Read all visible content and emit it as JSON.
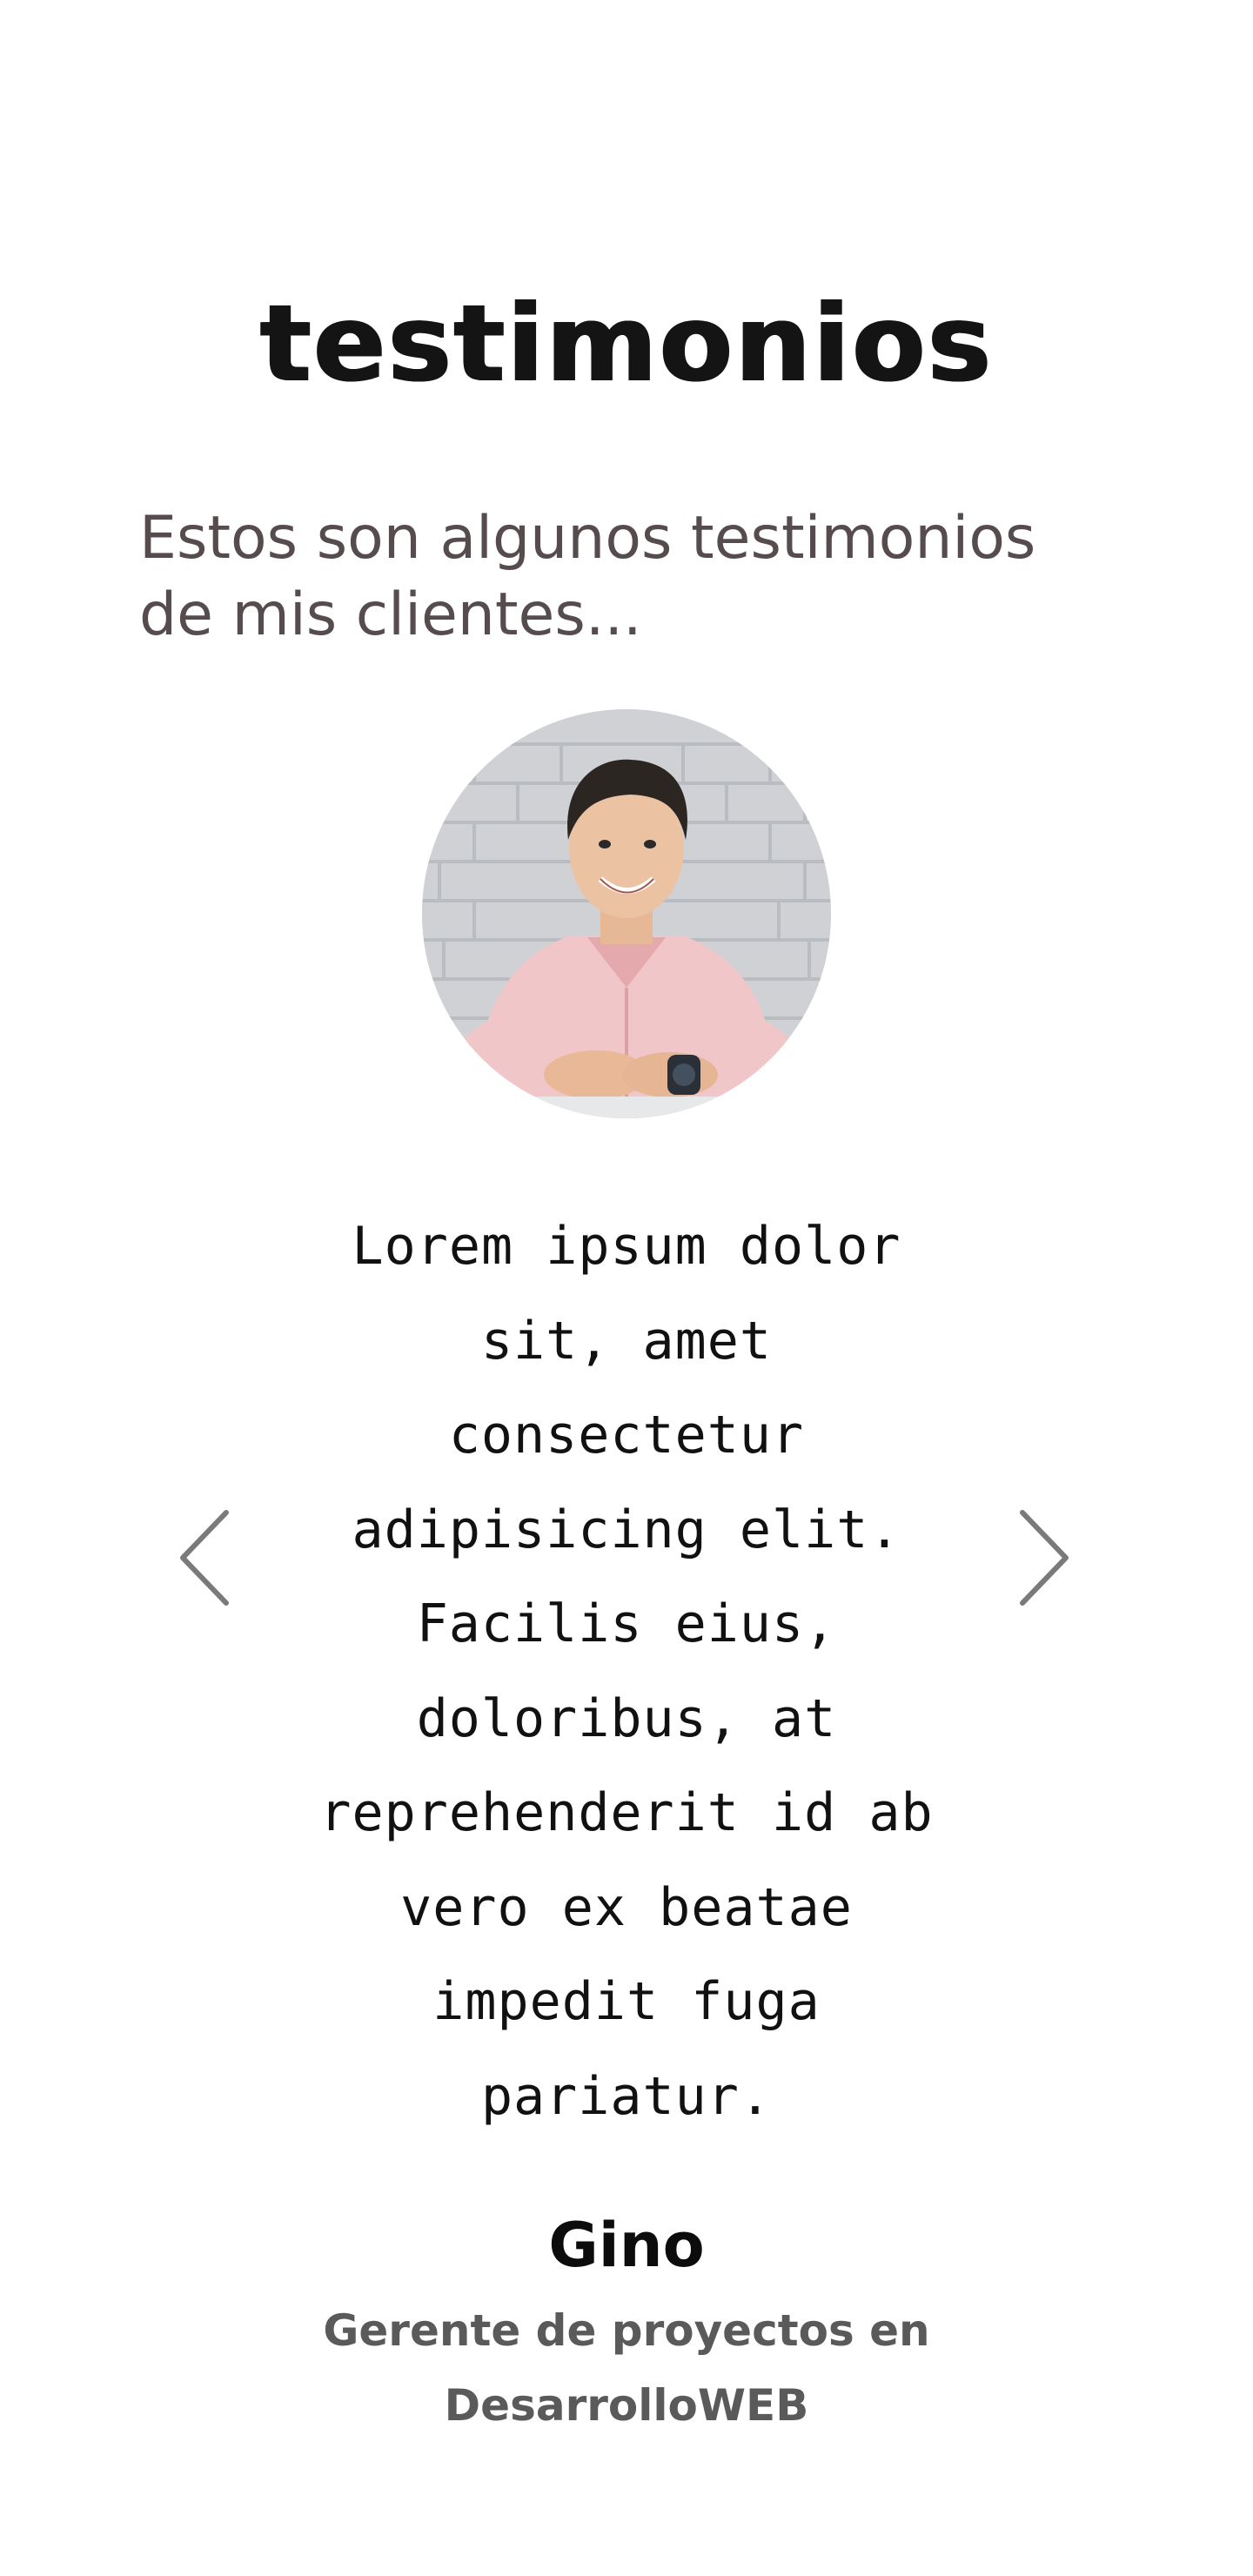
{
  "testimonials": {
    "title": "testimonios",
    "intro": "Estos son algunos testimonios de mis clientes...",
    "icons": {
      "prev": "chevron-left-icon",
      "next": "chevron-right-icon"
    },
    "arrow_color": "#7a7a7a",
    "current": {
      "quote": "Lorem ipsum dolor sit, amet consectetur adipisicing elit. Facilis eius, doloribus, at reprehenderit id ab vero ex beatae impedit fuga pariatur.",
      "name": "Gino",
      "role": "Gerente de proyectos en DesarrolloWEB"
    }
  }
}
